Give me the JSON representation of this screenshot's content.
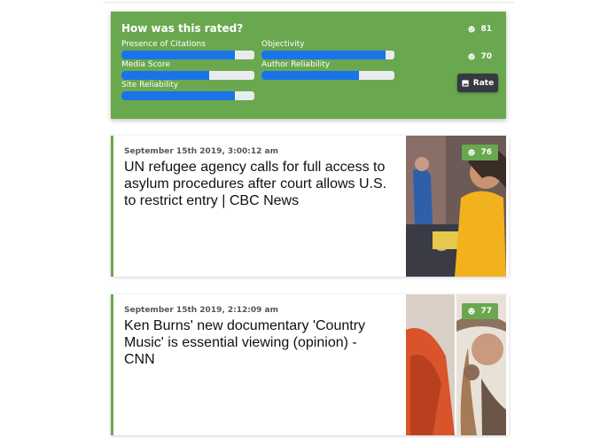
{
  "rating_panel": {
    "title": "How was this rated?",
    "metrics": [
      {
        "label": "Presence of Citations",
        "fraction": 0.85
      },
      {
        "label": "Objectivity",
        "fraction": 0.93
      },
      {
        "label": "Media Score",
        "fraction": 0.66
      },
      {
        "label": "Author Reliability",
        "fraction": 0.73
      },
      {
        "label": "Site Reliability",
        "fraction": 0.85
      }
    ],
    "scores": [
      "81",
      "70"
    ],
    "rate_label": "Rate"
  },
  "articles": [
    {
      "date": "September 15th 2019, 3:00:12 am",
      "headline": "UN refugee agency calls for full access to asylum procedures after court allows U.S. to restrict entry | CBC News",
      "score": "76"
    },
    {
      "date": "September 15th 2019, 2:12:09 am",
      "headline": "Ken Burns' new documentary 'Country Music' is essential viewing (opinion) - CNN",
      "score": "77"
    }
  ],
  "colors": {
    "panel_green": "#6aa84f",
    "bar_blue": "#1a73e8",
    "button_dark": "#343a40"
  }
}
